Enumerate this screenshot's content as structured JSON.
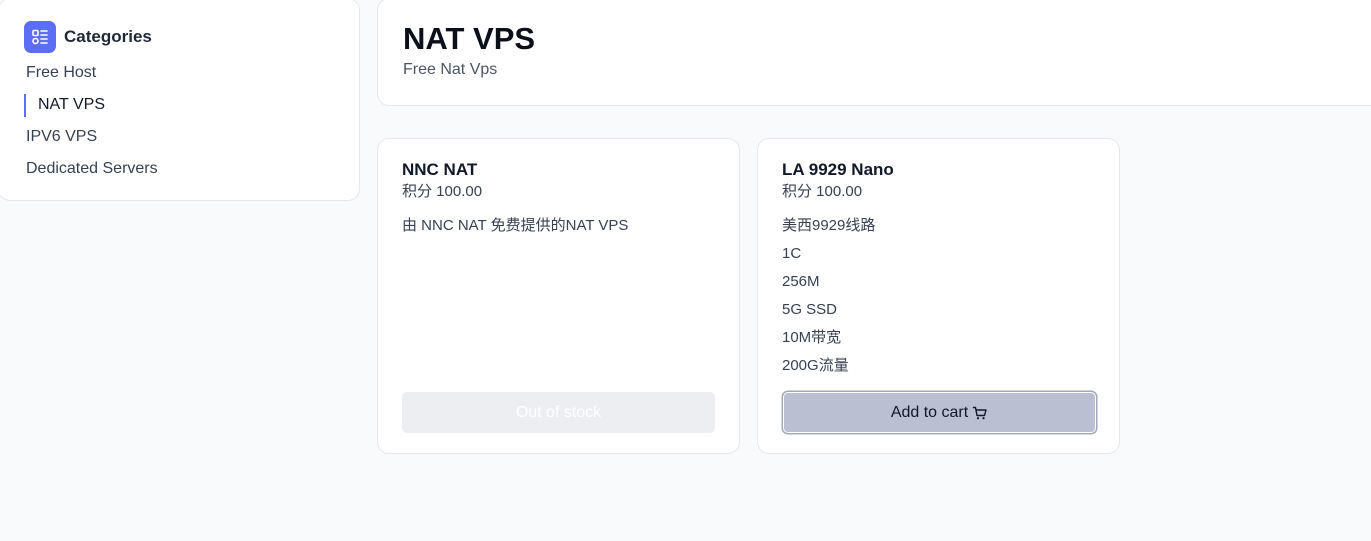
{
  "sidebar": {
    "title": "Categories",
    "icon": "categories-icon",
    "items": [
      {
        "label": "Free Host",
        "active": false
      },
      {
        "label": "NAT VPS",
        "active": true
      },
      {
        "label": "IPV6 VPS",
        "active": false
      },
      {
        "label": "Dedicated Servers",
        "active": false
      }
    ]
  },
  "header": {
    "title": "NAT VPS",
    "subtitle": "Free Nat Vps"
  },
  "products": [
    {
      "name": "NNC NAT",
      "price": "积分 100.00",
      "features": [
        "由 NNC NAT 免费提供的NAT VPS"
      ],
      "button_label": "Out of stock",
      "in_stock": false
    },
    {
      "name": "LA 9929 Nano",
      "price": "积分 100.00",
      "features": [
        "美西9929线路",
        "1C",
        "256M",
        "5G SSD",
        "10M带宽",
        "200G流量"
      ],
      "button_label": "Add to cart",
      "button_icon": "cart-icon",
      "in_stock": true
    }
  ],
  "colors": {
    "accent": "#5b6ef5",
    "background": "#f9fafc",
    "cart_button": "#babfd2",
    "disabled_button": "#eceef2"
  }
}
